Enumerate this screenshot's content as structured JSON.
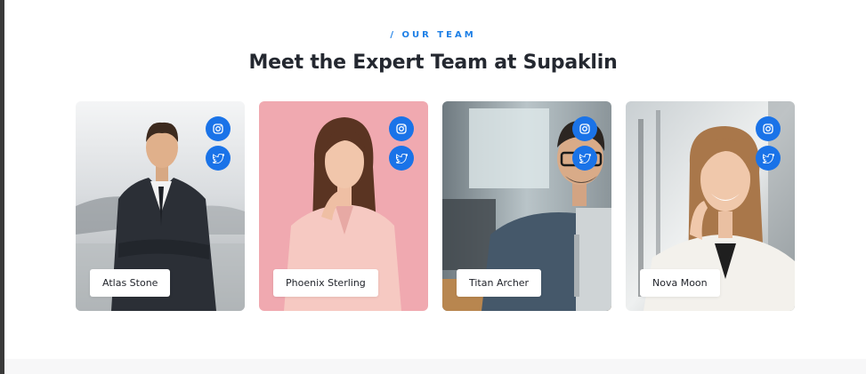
{
  "section": {
    "eyebrow": "/ OUR TEAM",
    "title": "Meet the Expert Team at Supaklin"
  },
  "team": [
    {
      "name": "Atlas Stone",
      "photo": "man-in-suit-arms-crossed",
      "socials": [
        "instagram-icon",
        "twitter-icon"
      ]
    },
    {
      "name": "Phoenix Sterling",
      "photo": "woman-pink-background",
      "socials": [
        "instagram-icon",
        "twitter-icon"
      ]
    },
    {
      "name": "Titan Archer",
      "photo": "man-with-glasses-laptop",
      "socials": [
        "instagram-icon",
        "twitter-icon"
      ]
    },
    {
      "name": "Nova Moon",
      "photo": "smiling-woman-white-jacket",
      "socials": [
        "instagram-icon",
        "twitter-icon"
      ]
    }
  ],
  "colors": {
    "accent": "#1a73e8",
    "eyebrow": "#1d7fe6",
    "heading": "#242830",
    "card2_bg": "#f0a9b0"
  }
}
